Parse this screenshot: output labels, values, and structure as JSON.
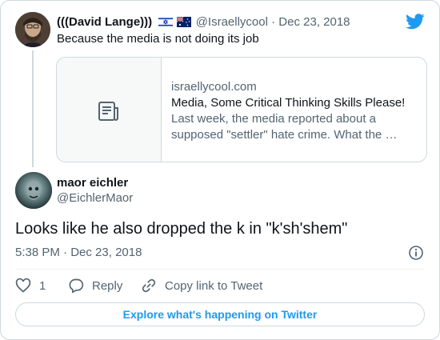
{
  "colors": {
    "accent": "#1d9bf0",
    "text_primary": "#0f1419",
    "text_secondary": "#536471",
    "border": "#cfd9de"
  },
  "logo": {
    "icon": "twitter-bird-icon"
  },
  "parent_tweet": {
    "display_name": "(((David Lange)))",
    "flags": [
      "israel-flag-icon",
      "australia-flag-icon"
    ],
    "handle": "@Israellycool",
    "separator": "·",
    "date": "Dec 23, 2018",
    "text": "Because the media is not doing its job",
    "link_card": {
      "thumb_icon": "article-icon",
      "domain": "israellycool.com",
      "title": "Media, Some Critical Thinking Skills Please!",
      "description": "Last week, the media reported about a supposed \"settler\" hate crime. What the …"
    }
  },
  "reply_tweet": {
    "display_name": "maor eichler",
    "handle": "@EichlerMaor",
    "text": "Looks like he also dropped the k in \"k'sh'shem\"",
    "time": "5:38 PM",
    "separator": "·",
    "date": "Dec 23, 2018",
    "info_icon": "info-icon"
  },
  "actions": {
    "like_count": "1",
    "reply_label": "Reply",
    "copy_label": "Copy link to Tweet"
  },
  "explore_label": "Explore what's happening on Twitter"
}
